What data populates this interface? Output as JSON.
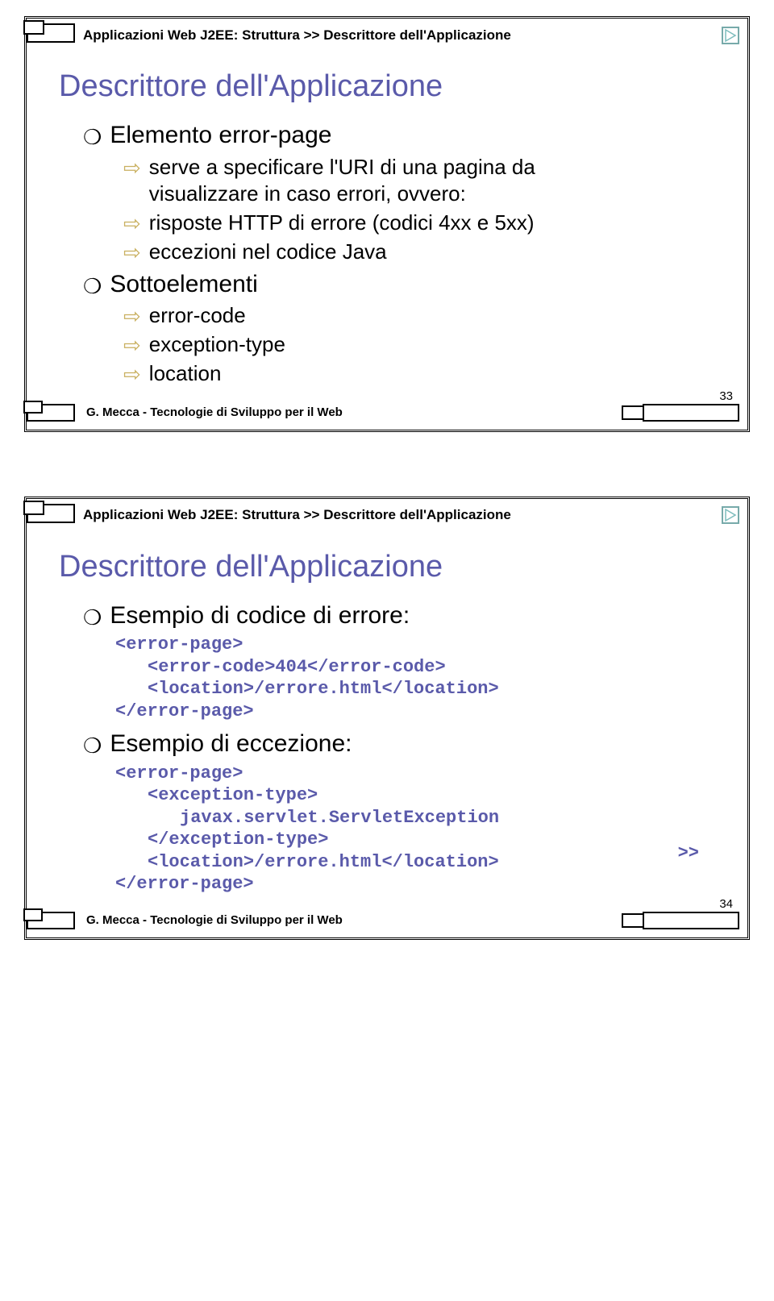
{
  "breadcrumb": "Applicazioni Web J2EE: Struttura >> Descrittore dell'Applicazione",
  "footer_text": "G. Mecca - Tecnologie di Sviluppo per il Web",
  "slide1": {
    "title": "Descrittore dell'Applicazione",
    "l1a": "Elemento error-page",
    "l2a": "serve a specificare l'URI di una pagina da",
    "l2a_cont": "visualizzare in caso errori, ovvero:",
    "l2b": "risposte HTTP di errore (codici 4xx e 5xx)",
    "l2c": "eccezioni nel codice Java",
    "l1b": "Sottoelementi",
    "l2d": "error-code",
    "l2e": "exception-type",
    "l2f": "location",
    "page_num": "33"
  },
  "slide2": {
    "title": "Descrittore dell'Applicazione",
    "l1a": "Esempio di codice di errore:",
    "code1_l1": "<error-page>",
    "code1_l2": "<error-code>404</error-code>",
    "code1_l3": "<location>/errore.html</location>",
    "code1_l4": "</error-page>",
    "l1b": "Esempio di eccezione:",
    "code2_l1": "<error-page>",
    "code2_l2": "<exception-type>",
    "code2_l3": "javax.servlet.ServletException",
    "code2_l4": "</exception-type>",
    "code2_l5": "<location>/errore.html</location>",
    "code2_l6": "</error-page>",
    "more": ">>",
    "page_num": "34"
  }
}
